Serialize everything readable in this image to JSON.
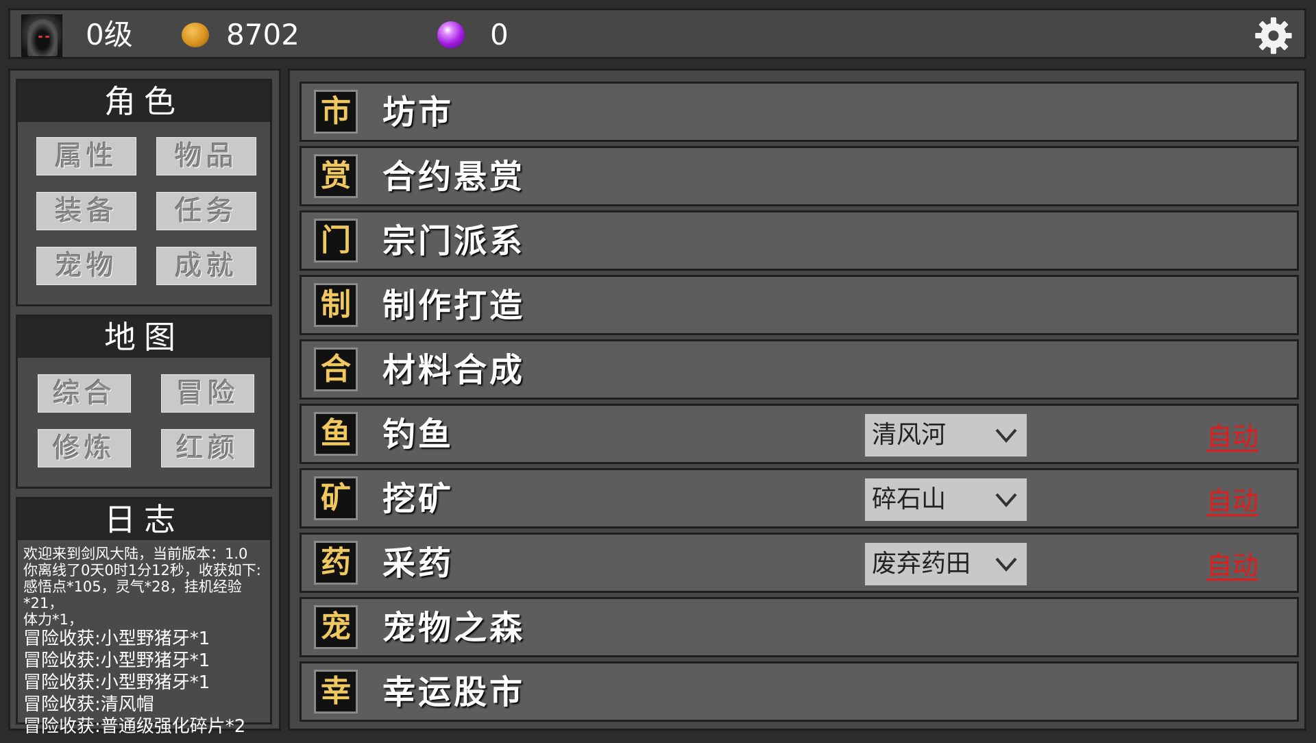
{
  "topbar": {
    "level": "0级",
    "coins": "8702",
    "gems": "0",
    "icons": {
      "avatar": "hooded-avatar-icon",
      "coin": "coin-icon",
      "gem": "purple-gem-icon",
      "settings": "gear-icon"
    }
  },
  "character": {
    "title": "角色",
    "buttons": [
      "属性",
      "物品",
      "装备",
      "任务",
      "宠物",
      "成就"
    ]
  },
  "map": {
    "title": "地图",
    "buttons": [
      "综合",
      "冒险",
      "修炼",
      "红颜"
    ]
  },
  "log": {
    "title": "日志",
    "lines": [
      "欢迎来到剑风大陆，当前版本：1.0",
      "你离线了0天0时1分12秒，收获如下:",
      "感悟点*105，灵气*28，挂机经验*21，",
      "体力*1，"
    ],
    "big_lines": [
      "冒险收获:小型野猪牙*1",
      "冒险收获:小型野猪牙*1",
      "冒险收获:小型野猪牙*1",
      "冒险收获:清风帽",
      "冒险收获:普通级强化碎片*2"
    ]
  },
  "menu": [
    {
      "icon": "市",
      "title": "坊市"
    },
    {
      "icon": "赏",
      "title": "合约悬赏"
    },
    {
      "icon": "门",
      "title": "宗门派系"
    },
    {
      "icon": "制",
      "title": "制作打造"
    },
    {
      "icon": "合",
      "title": "材料合成"
    },
    {
      "icon": "鱼",
      "title": "钓鱼",
      "select": "清风河",
      "auto": "自动"
    },
    {
      "icon": "矿",
      "title": "挖矿",
      "select": "碎石山",
      "auto": "自动"
    },
    {
      "icon": "药",
      "title": "采药",
      "select": "废弃药田",
      "auto": "自动"
    },
    {
      "icon": "宠",
      "title": "宠物之森"
    },
    {
      "icon": "幸",
      "title": "幸运股市"
    }
  ],
  "colors": {
    "background": "#2c2c2c",
    "panel": "#474747",
    "row": "#5d5d5d",
    "auto_red": "#e01c1c",
    "icon_gold": "#f0c860"
  }
}
